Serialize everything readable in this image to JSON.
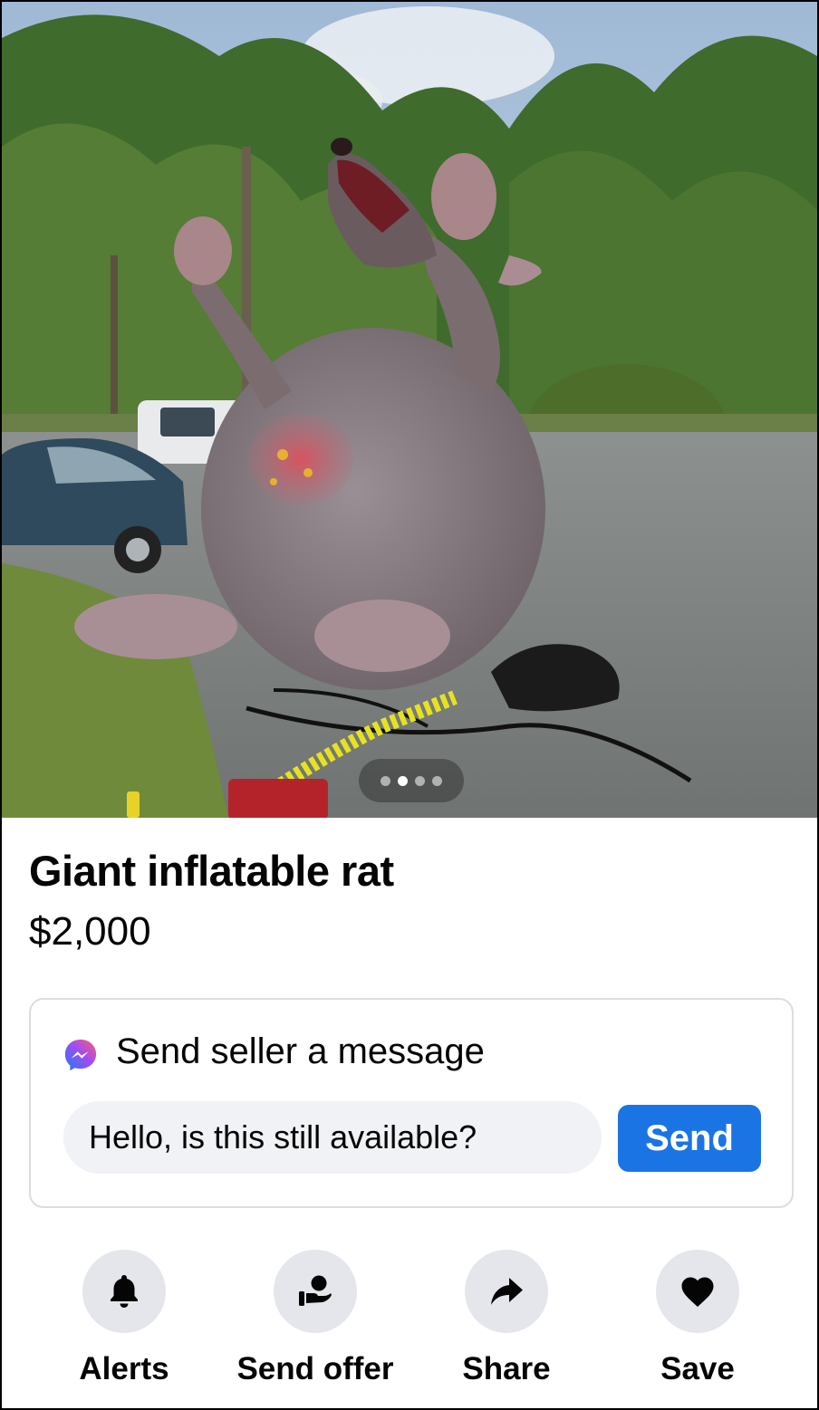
{
  "listing": {
    "title": "Giant inflatable rat",
    "price": "$2,000",
    "photo": {
      "subject": "inflatable-rat-photo",
      "page_count": 4,
      "current_page": 2
    }
  },
  "message_card": {
    "title": "Send seller a message",
    "icon": "messenger-icon",
    "input_value": "Hello, is this still available?",
    "send_label": "Send"
  },
  "actions": [
    {
      "label": "Alerts",
      "icon": "bell-icon"
    },
    {
      "label": "Send offer",
      "icon": "offer-icon"
    },
    {
      "label": "Share",
      "icon": "share-arrow-icon"
    },
    {
      "label": "Save",
      "icon": "heart-icon"
    }
  ],
  "colors": {
    "accent": "#1b74e4",
    "input_bg": "#f0f2f5",
    "action_bg": "#e4e6eb",
    "card_border": "#dadde1",
    "text": "#050505"
  }
}
